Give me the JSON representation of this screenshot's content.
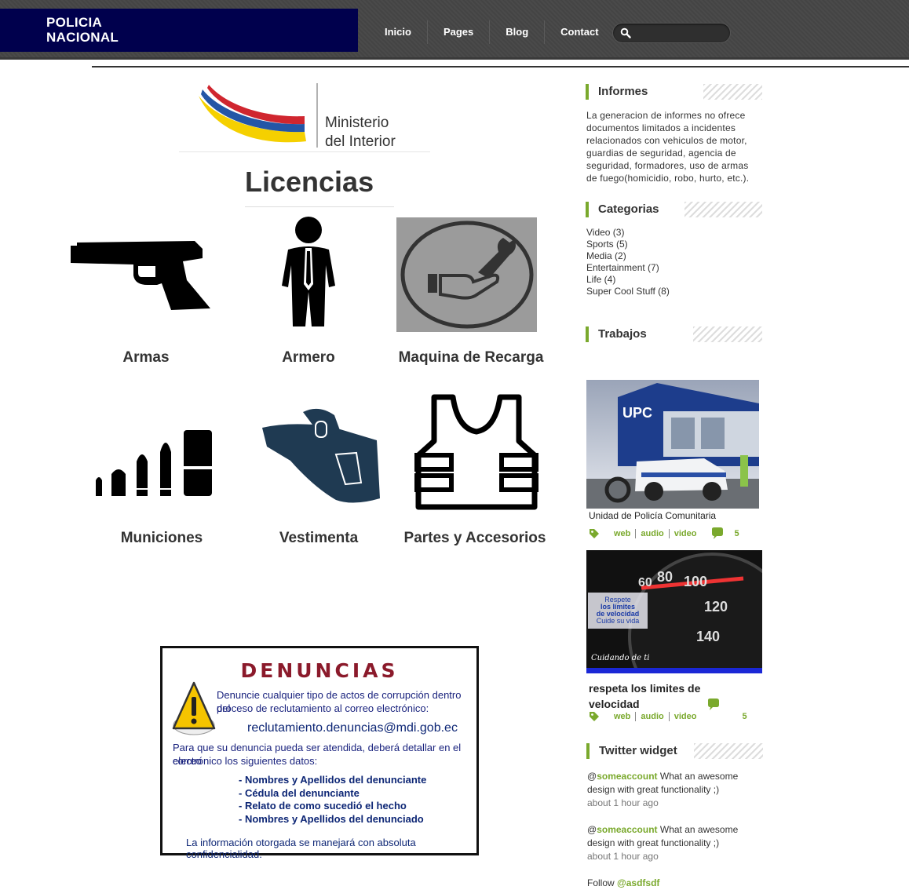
{
  "header": {
    "logo_line1": "POLICIA",
    "logo_line2": "NACIONAL",
    "nav": [
      "Inicio",
      "Pages",
      "Blog",
      "Contact"
    ],
    "search_placeholder": ""
  },
  "main": {
    "ministry_line1": "Ministerio",
    "ministry_line2": "del Interior",
    "title": "Licencias",
    "categories": [
      {
        "label": "Armas",
        "icon": "pistol-icon"
      },
      {
        "label": "Armero",
        "icon": "person-tie-icon"
      },
      {
        "label": "Maquina de Recarga",
        "icon": "wrench-hand-icon"
      },
      {
        "label": "Municiones",
        "icon": "bullets-icon"
      },
      {
        "label": "Vestimenta",
        "icon": "holster-icon"
      },
      {
        "label": "Partes y Accesorios",
        "icon": "vest-icon"
      }
    ],
    "denuncias": {
      "title": "DENUNCIAS",
      "line1": "Denuncie cualquier tipo de actos de corrupción dentro del",
      "line2": "proceso de reclutamiento al correo electrónico:",
      "email": "reclutamiento.denuncias@mdi.gob.ec",
      "line3": "Para que su denuncia pueda ser atendida, deberá detallar en el correo",
      "line4": "electrónico los siguientes datos:",
      "items": [
        "- Nombres y Apellidos del denunciante",
        "- Cédula del denunciante",
        "- Relato de como sucedió el hecho",
        "- Nombres y Apellidos del denunciado"
      ],
      "footer": "La información otorgada se manejará con absoluta confidencialidad."
    }
  },
  "sidebar": {
    "informes_title": "Informes",
    "informes_text": "La generacion de informes no ofrece documentos limitados a incidentes relacionados con vehiculos de motor, guardias de seguridad, agencia de seguridad, formadores, uso de armas de fuego(homicidio, robo, hurto, etc.).",
    "categorias_title": "Categorias",
    "categorias": [
      "Video (3)",
      "Sports (5)",
      "Media (2)",
      "Entertainment (7)",
      "Life (4)",
      "Super Cool Stuff (8)"
    ],
    "trabajos_title": "Trabajos",
    "posts": [
      {
        "title": "Unidad de Policía Comunitaria",
        "tags": [
          "web",
          "audio",
          "video"
        ],
        "comments": "5",
        "image_text": "UPC"
      },
      {
        "title": "respeta los limites de velocidad",
        "tags": [
          "web",
          "audio",
          "video"
        ],
        "comments": "5",
        "image_l1": "Respete",
        "image_l2": "los límites",
        "image_l3": "de velocidad",
        "image_l4": "Cuide su vida",
        "image_l5": "Cuidando de ti"
      }
    ],
    "twitter_title": "Twitter widget",
    "tweets": [
      {
        "at": "@",
        "account": "someaccount",
        "text": " What an awesome",
        "text2": "design with great functionality ;)",
        "time": "about 1 hour ago"
      },
      {
        "at": "@",
        "account": "someaccount",
        "text": " What an awesome",
        "text2": "design with great functionality ;)",
        "time": "about 1 hour ago"
      }
    ],
    "follow_prefix": "Follow ",
    "follow_account": "@asdfsdf"
  },
  "colors": {
    "accent": "#7aa92d",
    "navy": "#00004d",
    "header_bg": "#464646"
  }
}
